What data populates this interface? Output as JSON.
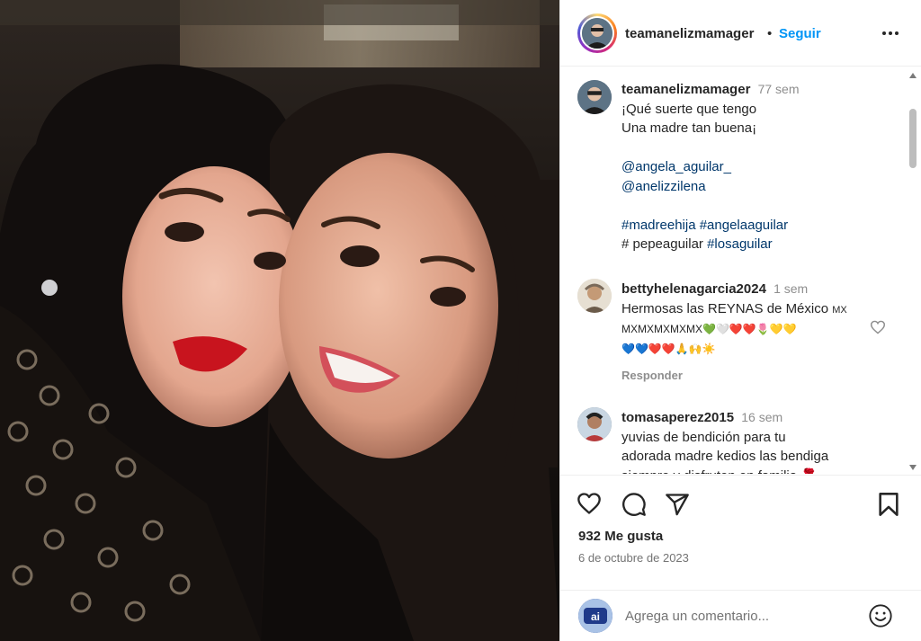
{
  "post": {
    "photo_alt": "photo",
    "author": "teamanelizmamager",
    "separator": "•",
    "follow_label": "Seguir"
  },
  "caption": {
    "username": "teamanelizmamager",
    "time": "77 sem",
    "lines": [
      "¡Qué suerte que tengo",
      "Una madre tan buena¡"
    ],
    "mentions": [
      "@angela_aguilar_",
      "@anelizzilena"
    ],
    "hashtags_line1": "#madreehija #angelaaguilar",
    "hashtags_line2_plain": "# pepeaguilar",
    "hashtags_line2_tag": "#losaguilar"
  },
  "comments": [
    {
      "username": "bettyhelenagarcia2024",
      "time": "1 sem",
      "text_line1": "Hermosas las REYNAS de México",
      "text_flag": "MX",
      "text_line2": "MXMXMXMXMX💚🤍❤️❤️🌷💛💛",
      "text_line3": "💙💙❤️❤️🙏🙌☀️",
      "reply_label": "Responder"
    },
    {
      "username": "tomasaperez2015",
      "time": "16 sem",
      "text_line1": "yuvias de bendición para tu",
      "text_line2": "adorada madre kedios las bendiga",
      "text_line3": "siempre y disfruten en familia 🌹"
    }
  ],
  "stats": {
    "likes": "932 Me gusta",
    "date": "6 de octubre de 2023"
  },
  "composer": {
    "placeholder": "Agrega un comentario..."
  },
  "icons": {
    "more": "more-options-icon",
    "like": "heart-icon",
    "comment": "comment-icon",
    "share": "paper-plane-icon",
    "save": "bookmark-icon",
    "emoji": "smiley-icon"
  },
  "colors": {
    "link": "#0095f6",
    "mention": "#00376b",
    "muted": "#8e8e8e",
    "text": "#262626"
  }
}
